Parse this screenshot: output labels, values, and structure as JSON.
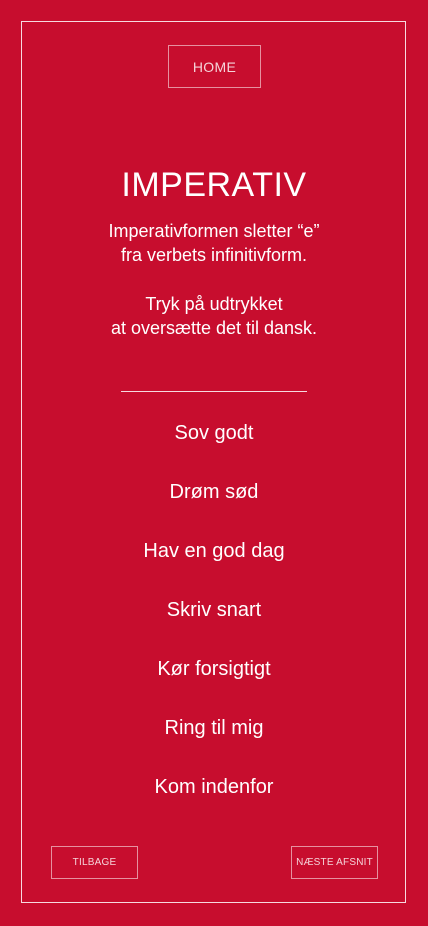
{
  "header": {
    "home_label": "HOME"
  },
  "main": {
    "title": "IMPERATIV",
    "description_line1": "Imperativformen sletter “e”",
    "description_line2": "fra verbets infinitivform.",
    "instruction_line1": "Tryk på udtrykket",
    "instruction_line2": "at oversætte det til dansk.",
    "phrases": [
      "Sov godt",
      "Drøm sød",
      "Hav en god dag",
      "Skriv snart",
      "Kør forsigtigt",
      "Ring til mig",
      "Kom indenfor"
    ]
  },
  "footer": {
    "back_label": "TILBAGE",
    "next_label": "NÆSTE AFSNIT"
  },
  "colors": {
    "background": "#c70d2e",
    "foreground": "#ffffff"
  }
}
